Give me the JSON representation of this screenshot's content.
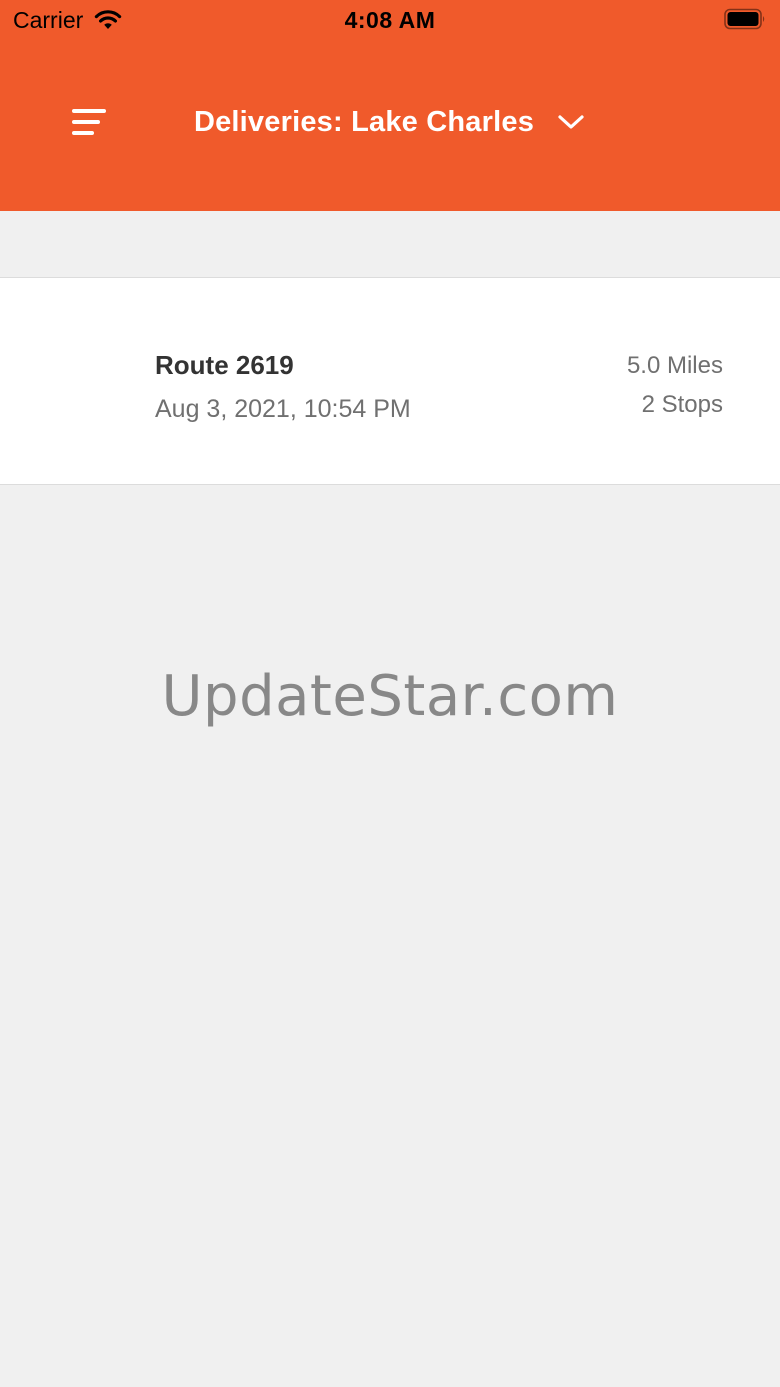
{
  "status_bar": {
    "carrier": "Carrier",
    "time": "4:08 AM",
    "wifi_icon": "wifi-icon",
    "battery_icon": "battery-icon"
  },
  "header": {
    "title": "Deliveries: Lake Charles",
    "menu_icon": "menu-icon",
    "dropdown_icon": "chevron-down-icon",
    "background_color": "#f05a2b"
  },
  "routes": [
    {
      "name": "Route 2619",
      "date": "Aug 3, 2021, 10:54 PM",
      "distance": "5.0 Miles",
      "stops": "2 Stops"
    }
  ],
  "watermark": "UpdateStar.com"
}
